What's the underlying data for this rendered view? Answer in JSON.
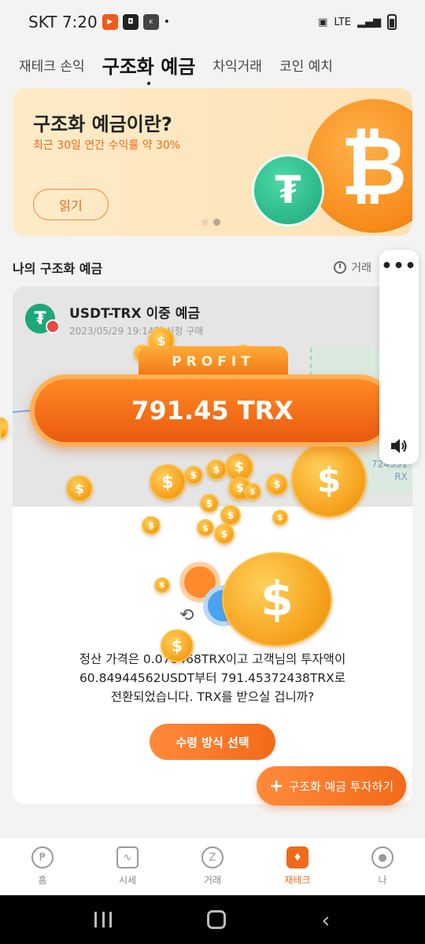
{
  "status_bar": {
    "carrier_time": "SKT 7:20",
    "network": "LTE"
  },
  "tabs": [
    {
      "label": "재테크 손익",
      "active": false
    },
    {
      "label": "구조화 예금",
      "active": true
    },
    {
      "label": "차익거래",
      "active": false
    },
    {
      "label": "코인 예치",
      "active": false
    }
  ],
  "banner": {
    "title": "구조화 예금이란?",
    "subtitle": "최근 30일 연간 수익률 약 30%",
    "button": "읽기"
  },
  "section": {
    "title": "나의 구조화 예금",
    "history_label": "거래"
  },
  "product": {
    "name": "USDT-TRX 이중 예금",
    "date": "2023/05/29 19:14일 신청 구매",
    "chart_value_line1": "724531",
    "chart_value_line2": "RX"
  },
  "profit": {
    "label": "PROFIT",
    "value": "791.45 TRX"
  },
  "settlement": {
    "line1": "정산 가격은 0.070468TRX이고 고객님의 투자액이",
    "line2": "60.84944562USDT부터 791.45372438TRX로",
    "line3": "전환되었습니다. TRX를 받으실 겁니까?"
  },
  "receive_button": "수령 방식 선택",
  "invest_button": "구조화 예금 투자하기",
  "bottom_nav": [
    {
      "label": "홈",
      "icon": "home-icon"
    },
    {
      "label": "시세",
      "icon": "chart-icon"
    },
    {
      "label": "거래",
      "icon": "trade-icon"
    },
    {
      "label": "재테크",
      "icon": "wealth-icon",
      "active": true
    },
    {
      "label": "나",
      "icon": "profile-icon"
    }
  ],
  "colors": {
    "accent": "#f06a1c",
    "banner_bg": "#fde7c2"
  }
}
